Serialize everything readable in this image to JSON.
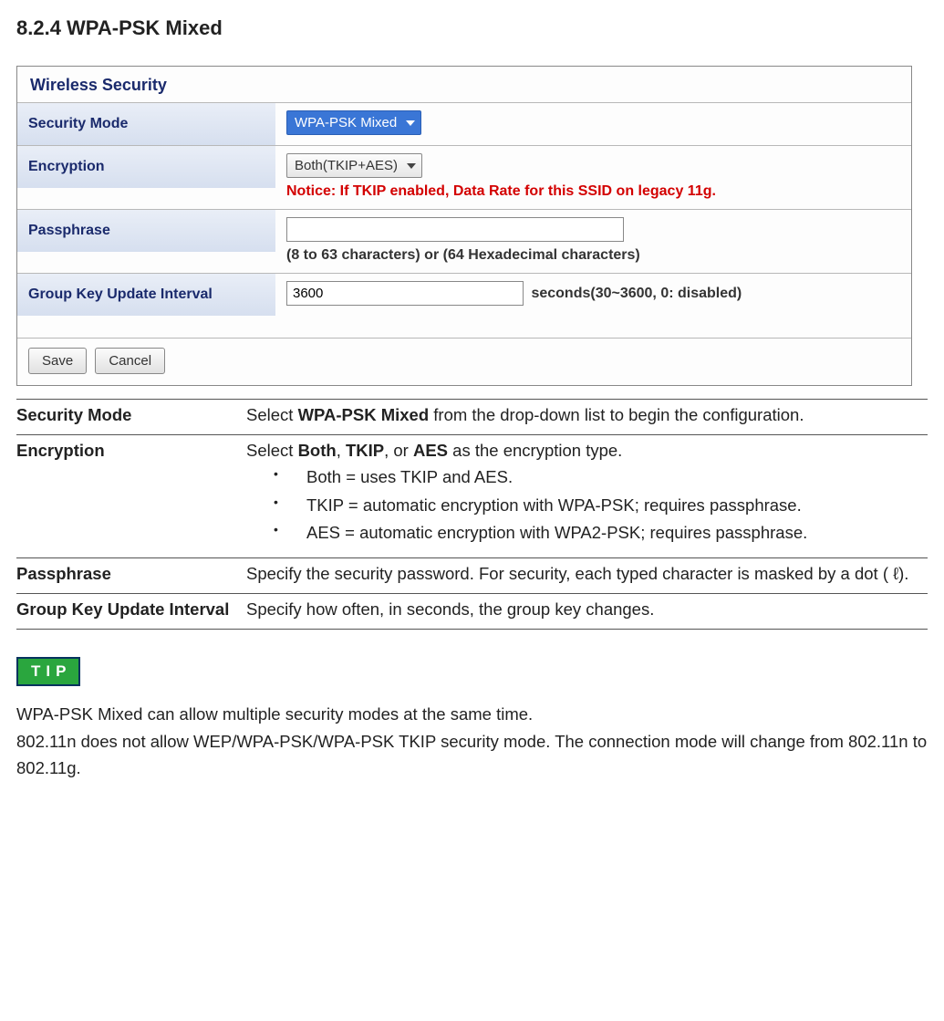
{
  "section_heading": "8.2.4 WPA-PSK Mixed",
  "screenshot": {
    "panel_title": "Wireless Security",
    "rows": {
      "security_mode": {
        "label": "Security Mode",
        "value": "WPA-PSK Mixed"
      },
      "encryption": {
        "label": "Encryption",
        "value": "Both(TKIP+AES)",
        "notice": "Notice: If TKIP enabled, Data Rate for this SSID on legacy 11g."
      },
      "passphrase": {
        "label": "Passphrase",
        "value": "",
        "hint": "(8 to 63 characters) or (64 Hexadecimal characters)"
      },
      "group_key": {
        "label": "Group Key Update Interval",
        "value": "3600",
        "suffix": "seconds(30~3600, 0: disabled)"
      }
    },
    "buttons": {
      "save": "Save",
      "cancel": "Cancel"
    }
  },
  "description": {
    "security_mode": {
      "term": "Security Mode",
      "text_pre": "Select ",
      "bold": "WPA-PSK Mixed",
      "text_post": " from the drop-down list to begin the configuration."
    },
    "encryption": {
      "term": "Encryption",
      "intro_pre": "Select ",
      "bold1": "Both",
      "sep1": ", ",
      "bold2": "TKIP",
      "sep2": ", or ",
      "bold3": "AES",
      "intro_post": " as the encryption type.",
      "bullets": [
        "Both = uses TKIP and AES.",
        "TKIP = automatic encryption with WPA-PSK; requires passphrase.",
        "AES = automatic encryption with WPA2-PSK; requires passphrase."
      ]
    },
    "passphrase": {
      "term": "Passphrase",
      "text": "Specify the security password. For security, each typed character is masked by a dot (   ℓ)."
    },
    "group_key": {
      "term": "Group Key Update Interval",
      "text": "Specify how often, in seconds, the group key changes."
    }
  },
  "tip": {
    "badge": "TIP",
    "line1": "WPA-PSK Mixed can allow multiple security modes at the same time.",
    "line2": "802.11n does not allow WEP/WPA-PSK/WPA-PSK TKIP security mode. The connection mode will change from 802.11n to 802.11g."
  }
}
